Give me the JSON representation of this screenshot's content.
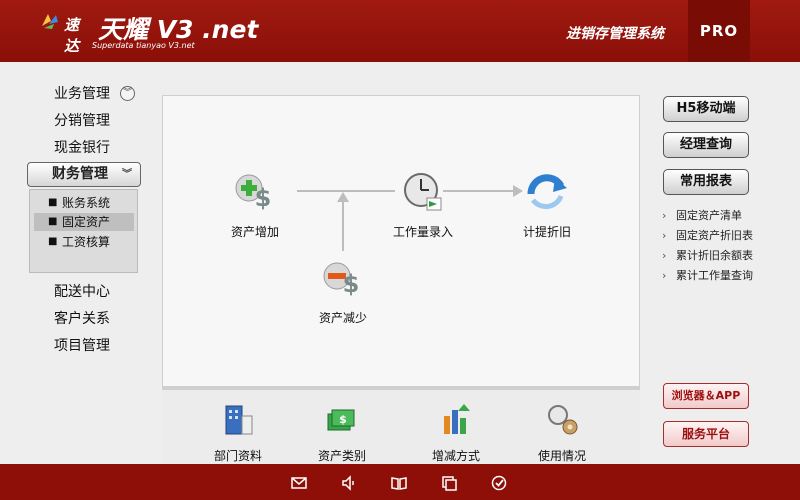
{
  "header": {
    "brand": "速达",
    "product": "天耀 V3 .net",
    "subtitle": "Superdata tianyao V3.net",
    "system_title": "进销存管理系统",
    "edition": "PRO"
  },
  "sidebar": {
    "items": [
      {
        "label": "业务管理"
      },
      {
        "label": "分销管理"
      },
      {
        "label": "现金银行"
      },
      {
        "label": "财务管理"
      },
      {
        "label": "配送中心"
      },
      {
        "label": "客户关系"
      },
      {
        "label": "项目管理"
      }
    ],
    "submenu": [
      {
        "label": "账务系统"
      },
      {
        "label": "固定资产"
      },
      {
        "label": "工资核算"
      }
    ]
  },
  "flow": {
    "asset_add": "资产增加",
    "workload": "工作量录入",
    "depreciation": "计提折旧",
    "asset_reduce": "资产减少"
  },
  "tools": {
    "dept": "部门资料",
    "category": "资产类别",
    "change_method": "增减方式",
    "usage": "使用情况"
  },
  "right": {
    "h5": "H5移动端",
    "manager": "经理查询",
    "reports": "常用报表",
    "links": [
      "固定资产清单",
      "固定资产折旧表",
      "累计折旧余额表",
      "累计工作量查询"
    ],
    "browser": "浏览器＆APP",
    "service": "服务平台"
  },
  "footer_icons": [
    "mail-icon",
    "speaker-icon",
    "book-icon",
    "window-icon",
    "check-icon"
  ],
  "colors": {
    "header": "#8e0f08",
    "accent_red": "#9a1010"
  }
}
